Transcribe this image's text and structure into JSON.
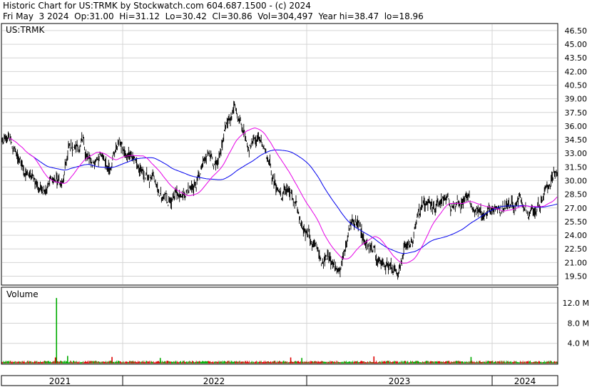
{
  "header": {
    "line1": "Historic Chart for US:TRMK by Stockwatch.com 604.687.1500 - (c) 2024",
    "line2": "Fri May  3 2024  Op:31.00  Hi=31.12  Lo=30.42  Cl=30.86  Vol=304,497  Year hi=38.47  lo=18.96"
  },
  "chart_data": [
    {
      "type": "line",
      "symbol_label": "US:TRMK",
      "y_ticks": [
        "46.50",
        "45.00",
        "43.50",
        "42.00",
        "40.50",
        "39.00",
        "37.50",
        "36.00",
        "34.50",
        "33.00",
        "31.50",
        "30.00",
        "28.50",
        "27.00",
        "25.50",
        "24.00",
        "22.50",
        "21.00",
        "19.50"
      ],
      "ylim": [
        18.6,
        47.2
      ],
      "x_years": [
        "2021",
        "2022",
        "2023",
        "2024"
      ],
      "grid": true,
      "price_keypoints": {
        "t": [
          0.0,
          0.015,
          0.04,
          0.07,
          0.09,
          0.11,
          0.12,
          0.145,
          0.16,
          0.175,
          0.19,
          0.21,
          0.225,
          0.235,
          0.25,
          0.27,
          0.28,
          0.305,
          0.32,
          0.335,
          0.35,
          0.365,
          0.375,
          0.39,
          0.405,
          0.42,
          0.445,
          0.46,
          0.475,
          0.49,
          0.505,
          0.515,
          0.525,
          0.535,
          0.55,
          0.57,
          0.58,
          0.59,
          0.6,
          0.615,
          0.63,
          0.64,
          0.65,
          0.665,
          0.675,
          0.69,
          0.705,
          0.715,
          0.725,
          0.74,
          0.75,
          0.77,
          0.78,
          0.795,
          0.8,
          0.81,
          0.83,
          0.855,
          0.86,
          0.87,
          0.877,
          0.885,
          0.895,
          0.915,
          0.94,
          0.96,
          0.97,
          0.98,
          0.99,
          1.0
        ],
        "v": [
          34.2,
          34.1,
          31.0,
          29.2,
          30.3,
          29.6,
          33.4,
          33.9,
          31.5,
          33.0,
          31.4,
          34.6,
          32.2,
          33.4,
          30.7,
          30.2,
          28.3,
          27.3,
          28.9,
          29.1,
          29.6,
          31.8,
          33.3,
          31.0,
          36.5,
          37.6,
          34.5,
          35.1,
          34.0,
          29.9,
          28.2,
          29.3,
          27.4,
          25.6,
          24.6,
          21.8,
          20.6,
          22.1,
          20.7,
          21.7,
          25.5,
          25.8,
          23.5,
          22.1,
          21.4,
          21.0,
          20.2,
          19.1,
          22.1,
          22.8,
          26.1,
          28.0,
          26.8,
          28.0,
          27.3,
          27.4,
          27.4,
          27.0,
          27.3,
          26.5,
          27.4,
          26.7,
          27.3,
          27.5,
          27.8,
          26.9,
          28.0,
          29.1,
          30.3,
          30.9
        ]
      },
      "moving_average_short_color": "#e600e6",
      "moving_average_long_color": "#0000ee",
      "price_color": "#000000"
    },
    {
      "type": "bar",
      "title": "Volume",
      "y_ticks": [
        "12.0 M",
        "8.0 M",
        "4.0 M"
      ],
      "ylim": [
        0,
        15.0
      ],
      "spikes": [
        {
          "t": 0.098,
          "value": 13.0
        },
        {
          "t": 0.096,
          "value": 1.2
        },
        {
          "t": 0.118,
          "value": 1.5
        },
        {
          "t": 0.198,
          "value": 1.3
        },
        {
          "t": 0.285,
          "value": 1.1
        },
        {
          "t": 0.52,
          "value": 1.2
        },
        {
          "t": 0.54,
          "value": 1.1
        },
        {
          "t": 0.67,
          "value": 1.4
        },
        {
          "t": 0.845,
          "value": 1.3
        }
      ],
      "baseline_volume": 0.4,
      "up_color": "#00aa00",
      "down_color": "#dd0000"
    }
  ]
}
